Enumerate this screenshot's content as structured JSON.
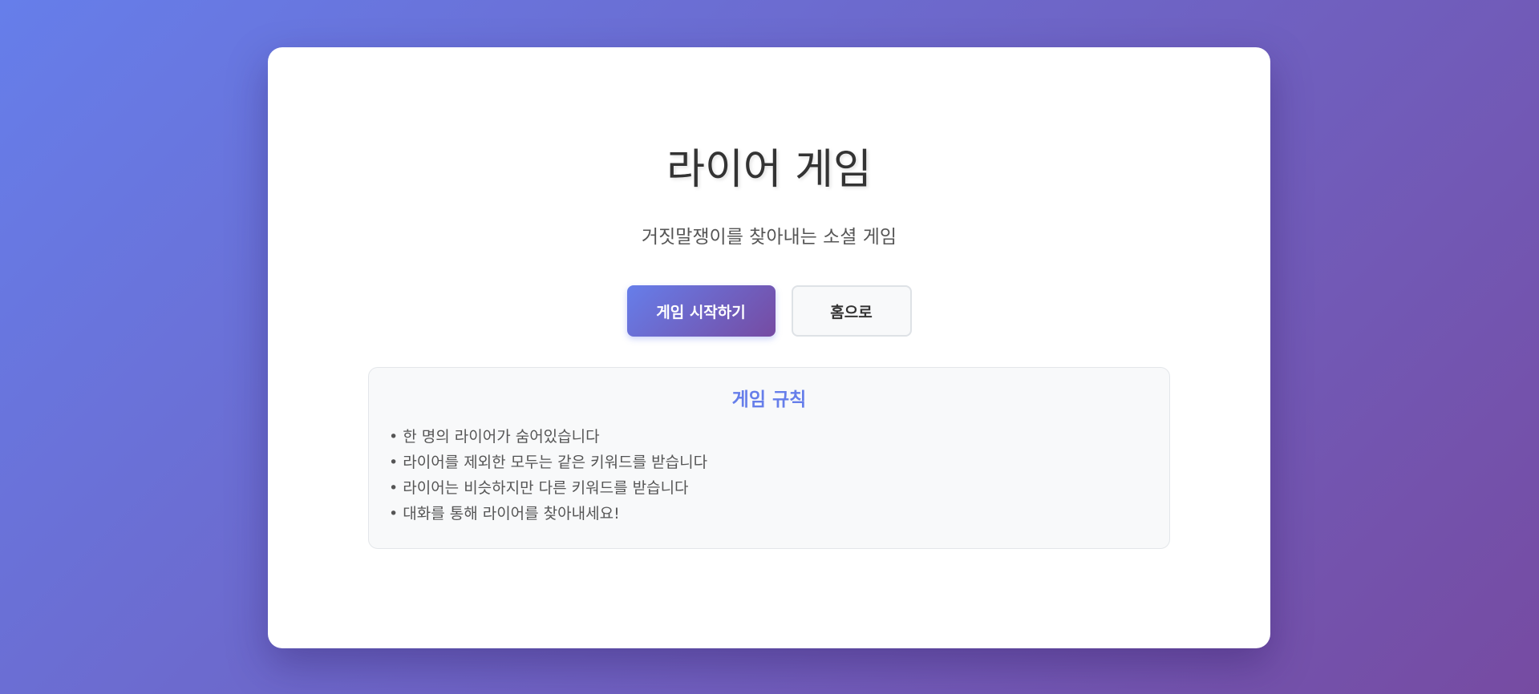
{
  "page": {
    "title": "라이어 게임",
    "subtitle": "거짓말쟁이를 찾아내는 소셜 게임"
  },
  "buttons": {
    "start_label": "게임 시작하기",
    "home_label": "홈으로"
  },
  "rules": {
    "title": "게임 규칙",
    "items": [
      "• 한 명의 라이어가 숨어있습니다",
      "• 라이어를 제외한 모두는 같은 키워드를 받습니다",
      "• 라이어는 비슷하지만 다른 키워드를 받습니다",
      "• 대화를 통해 라이어를 찾아내세요!"
    ]
  },
  "colors": {
    "background_gradient_start": "#667eea",
    "background_gradient_end": "#764ba2",
    "accent": "#667eea",
    "card": "#ffffff"
  }
}
